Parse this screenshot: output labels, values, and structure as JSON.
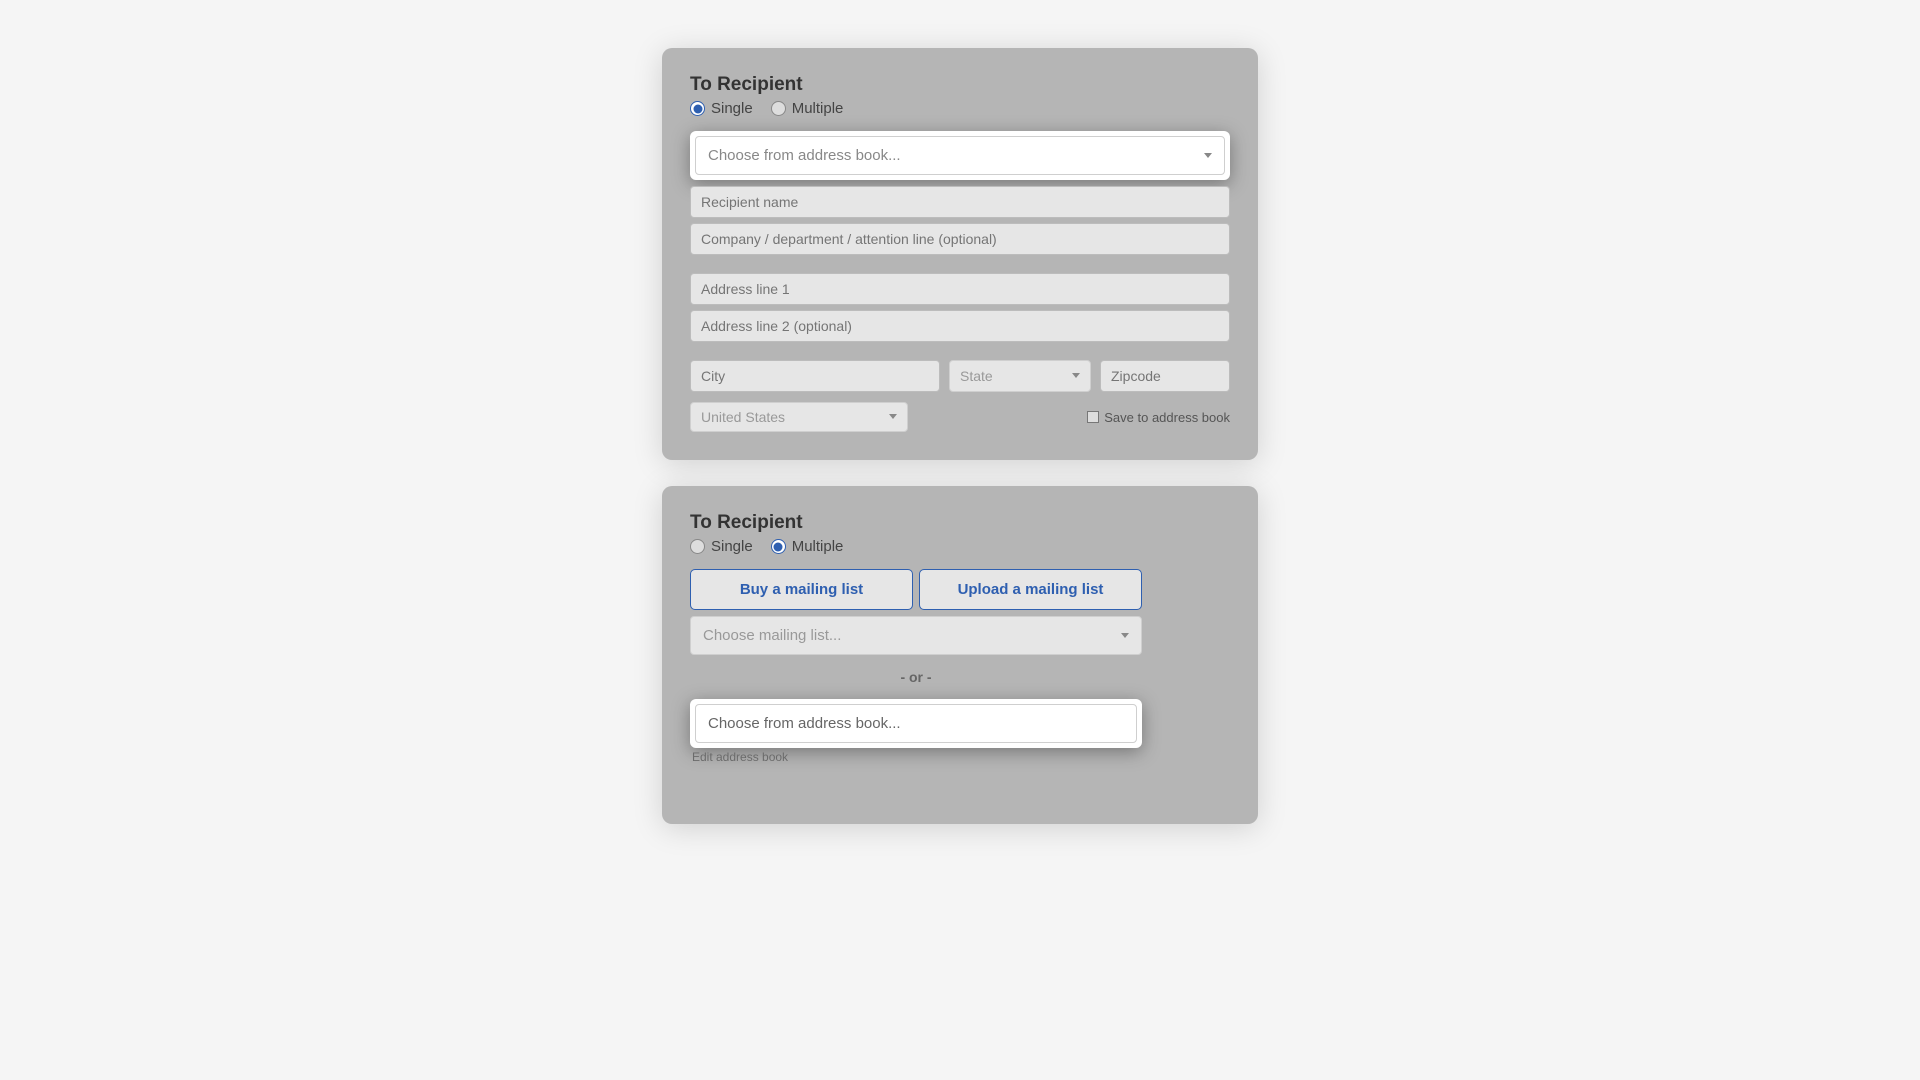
{
  "panel1": {
    "title": "To Recipient",
    "radios": {
      "single": "Single",
      "multiple": "Multiple",
      "selected": "single"
    },
    "address_book_placeholder": "Choose from address book...",
    "fields": {
      "recipient_name": "Recipient name",
      "company_line": "Company / department / attention line (optional)",
      "address1": "Address line 1",
      "address2": "Address line 2 (optional)",
      "city": "City",
      "state": "State",
      "zipcode": "Zipcode",
      "country": "United States"
    },
    "save_label": "Save to address book"
  },
  "panel2": {
    "title": "To Recipient",
    "radios": {
      "single": "Single",
      "multiple": "Multiple",
      "selected": "multiple"
    },
    "buy_btn": "Buy a mailing list",
    "upload_btn": "Upload a mailing list",
    "mailing_placeholder": "Choose mailing list...",
    "or_text": "- or -",
    "address_book_placeholder": "Choose from address book...",
    "edit_link": "Edit address book"
  }
}
